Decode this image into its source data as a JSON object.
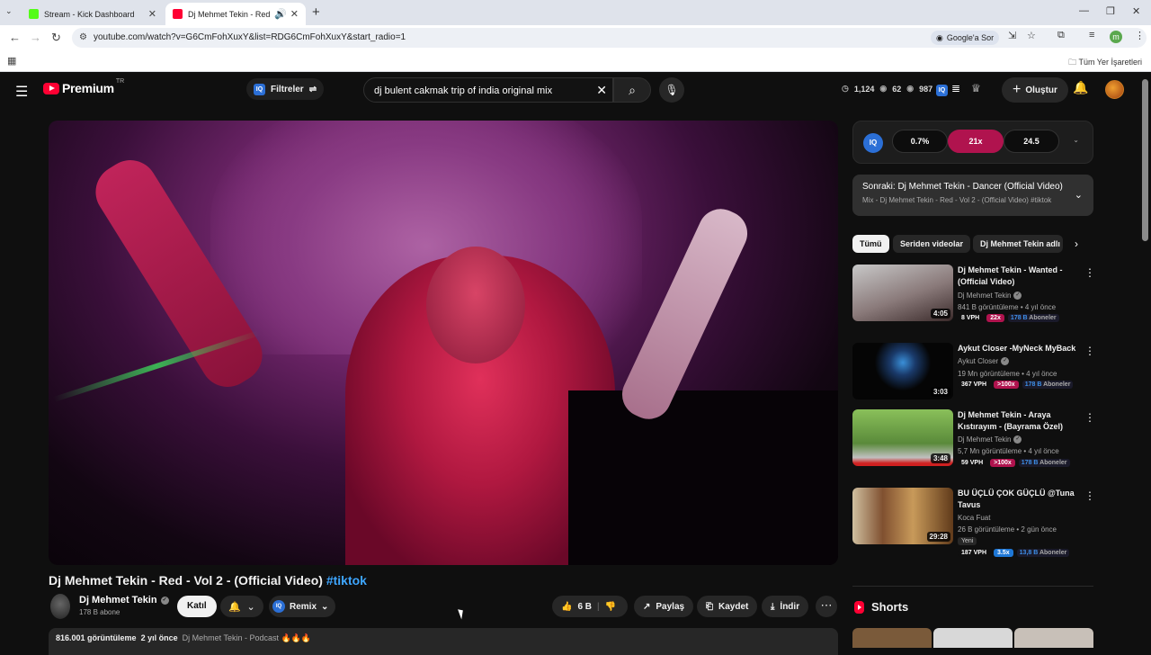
{
  "browser": {
    "tabs": [
      {
        "title": "Stream - Kick Dashboard",
        "active": false
      },
      {
        "title": "Dj Mehmet Tekin - Red - Vo",
        "active": true
      }
    ],
    "url": "youtube.com/watch?v=G6CmFohXuxY&list=RDG6CmFohXuxY&start_radio=1",
    "google_chip": "Google'a Sor",
    "profile_initial": "m",
    "bookmarks_label": "Tüm Yer İşaretleri"
  },
  "header": {
    "logo": "Premium",
    "country": "TR",
    "filter_label": "Filtreler",
    "iq": "IQ",
    "search_query": "dj bulent cakmak trip of india original mix",
    "stats": {
      "a": "1,124",
      "b": "62",
      "c": "987"
    },
    "create_label": "Oluştur"
  },
  "video": {
    "title": "Dj Mehmet Tekin - Red - Vol 2 - (Official Video)",
    "hashtag": "#tiktok",
    "channel": "Dj Mehmet Tekin",
    "subscribers": "178 B abone",
    "join_label": "Katıl",
    "remix_label": "Remix",
    "likes": "6 B",
    "share_label": "Paylaş",
    "save_label": "Kaydet",
    "download_label": "İndir",
    "views": "816.001 görüntüleme",
    "age": "2 yıl önce",
    "desc_snippet": "Dj Mehmet Tekin - Podcast 🔥🔥🔥"
  },
  "iq_panel": {
    "badge": "IQ",
    "stats": [
      "0.7%",
      "21x",
      "24.5"
    ]
  },
  "up_next": {
    "line1": "Sonraki: Dj Mehmet Tekin - Dancer (Official Video)",
    "line2": "Mix - Dj Mehmet Tekin - Red - Vol 2 - (Official Video) #tiktok"
  },
  "chips": [
    "Tümü",
    "Seriden videolar",
    "Dj Mehmet Tekin adlı"
  ],
  "recommendations": [
    {
      "title": "Dj Mehmet Tekin - Wanted - (Official Video)",
      "channel": "Dj Mehmet Tekin",
      "meta": "841 B görüntüleme • 4 yıl önce",
      "duration": "4:05",
      "vph": "8 VPH",
      "mult": "22x",
      "subs": "178 B",
      "subs_label": "Aboneler",
      "thumb_color": "#9a9a9a"
    },
    {
      "title": "Aykut Closer -MyNeck MyBack",
      "channel": "Aykut Closer",
      "meta": "19 Mn görüntüleme • 4 yıl önce",
      "duration": "3:03",
      "vph": "367 VPH",
      "mult": ">100x",
      "subs": "178 B",
      "subs_label": "Aboneler",
      "thumb_color": "#0a0a0a"
    },
    {
      "title": "Dj Mehmet Tekin - Araya Kıstırayım - (Bayrama Özel)",
      "channel": "Dj Mehmet Tekin",
      "meta": "5,7 Mn görüntüleme • 4 yıl önce",
      "duration": "3:48",
      "vph": "59 VPH",
      "mult": ">100x",
      "subs": "178 B",
      "subs_label": "Aboneler",
      "thumb_color": "#6a9a4a"
    },
    {
      "title": "BU ÜÇLÜ ÇOK GÜÇLÜ @Tuna Tavus",
      "channel": "Koca Fuat",
      "meta": "26 B görüntüleme • 2 gün önce",
      "new_label": "Yeni",
      "duration": "29:28",
      "vph": "187 VPH",
      "mult": "3.5x",
      "subs": "13,8 B",
      "subs_label": "Aboneler",
      "thumb_color": "#c07a2a"
    }
  ],
  "shorts_label": "Shorts"
}
